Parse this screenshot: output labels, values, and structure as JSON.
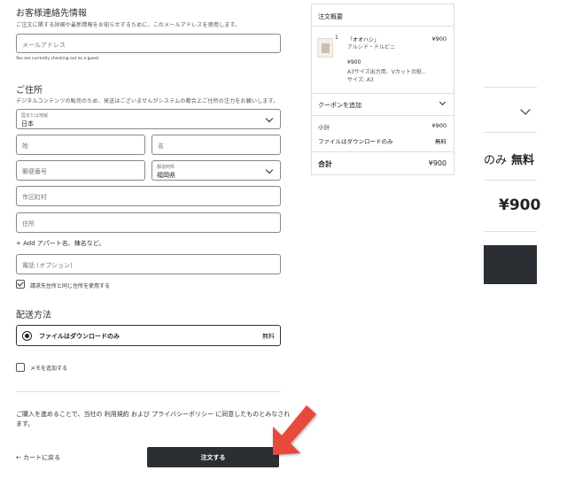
{
  "contact": {
    "heading": "お客様連絡先情報",
    "desc": "ご注文に関する詳細や最新情報をお知らせするために、このメールアドレスを使用します。",
    "email_placeholder": "メールアドレス",
    "guest_note": "You are currently checking out as a guest."
  },
  "address": {
    "heading": "ご住所",
    "desc": "デジタルコンテンツの販売のため、発送はございませんがシステムの都合上ご住所の注力をお願いします。",
    "country_label": "国または地域",
    "country_value": "日本",
    "last_name": "姓",
    "first_name": "名",
    "postal": "郵便番号",
    "pref_label": "都道府県",
    "pref_value": "福岡県",
    "city": "市区町村",
    "street": "住所",
    "add_apartment": "+ Add アパート名、棟名など。",
    "phone": "電話 (オプション)",
    "same_billing": "請求先住所と同じ住所を使用する"
  },
  "shipping": {
    "heading": "配送方法",
    "option_label": "ファイルはダウンロードのみ",
    "option_price": "無料"
  },
  "memo": {
    "label": "メモを追加する"
  },
  "terms": "ご購入を進めることで、当社の 利用規約 および プライバシーポリシー に同意したものとみなされます。",
  "actions": {
    "back": "← カートに戻る",
    "submit": "注文する"
  },
  "summary": {
    "title": "注文概要",
    "item": {
      "qty": "1",
      "name": "「オオハシ」",
      "artist": "アルシド・ドルビニ",
      "price": "¥900",
      "unit_price": "¥900",
      "desc": "A3サイズ出力用、Vカット台紙...",
      "size": "サイズ: A3"
    },
    "coupon": "クーポンを追加",
    "subtotal_label": "小計",
    "subtotal_value": "¥900",
    "shipping_label": "ファイルはダウンロードのみ",
    "shipping_value": "無料",
    "total_label": "合計",
    "total_value": "¥900"
  },
  "right_panel": {
    "shipping_partial": "のみ",
    "shipping_free": "無料",
    "total": "¥900"
  },
  "colors": {
    "dark_button": "#2b2f33",
    "arrow": "#e84a3c"
  }
}
